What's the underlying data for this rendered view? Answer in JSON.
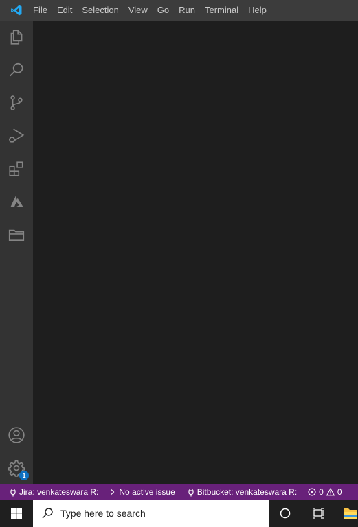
{
  "titlebar": {
    "logo": "vscode-logo",
    "menu": [
      "File",
      "Edit",
      "Selection",
      "View",
      "Go",
      "Run",
      "Terminal",
      "Help"
    ]
  },
  "activitybar": {
    "items": [
      {
        "icon": "files-icon"
      },
      {
        "icon": "search-icon"
      },
      {
        "icon": "source-control-icon"
      },
      {
        "icon": "run-debug-icon"
      },
      {
        "icon": "extensions-icon"
      },
      {
        "icon": "azure-icon"
      },
      {
        "icon": "folder-icon"
      }
    ],
    "bottom": [
      {
        "icon": "account-icon"
      },
      {
        "icon": "settings-gear-icon",
        "badge": "1"
      }
    ]
  },
  "statusbar": {
    "background": "#68217a",
    "jira_label": "Jira: venkateswara R:",
    "issue_label": "No active issue",
    "bitbucket_label": "Bitbucket: venkateswara R:",
    "errors": "0",
    "warnings": "0",
    "annotation_color": "#e81123"
  },
  "taskbar": {
    "search_placeholder": "Type here to search"
  }
}
